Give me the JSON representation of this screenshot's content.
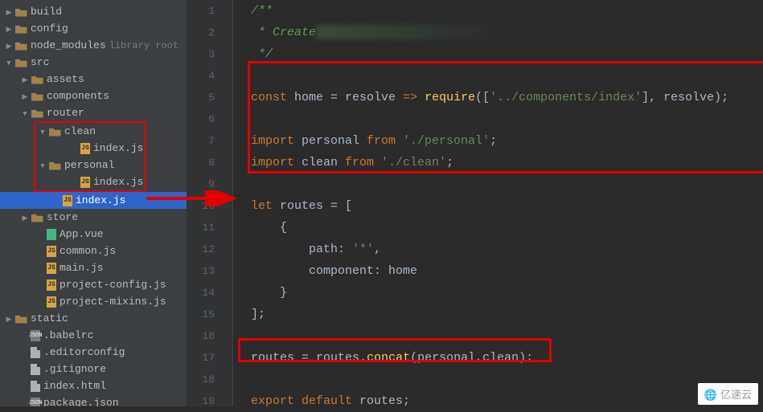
{
  "tree": {
    "build": "build",
    "config": "config",
    "node_modules": "node_modules",
    "node_modules_hint": "library root",
    "src": "src",
    "assets": "assets",
    "components": "components",
    "router": "router",
    "clean": "clean",
    "clean_index": "index.js",
    "personal": "personal",
    "personal_index": "index.js",
    "router_index": "index.js",
    "store": "store",
    "app_vue": "App.vue",
    "common_js": "common.js",
    "main_js": "main.js",
    "project_config": "project-config.js",
    "project_mixins": "project-mixins.js",
    "static": "static",
    "babelrc": ".babelrc",
    "editorconfig": ".editorconfig",
    "gitignore": ".gitignore",
    "index_html": "index.html",
    "package_json": "package.json"
  },
  "line_numbers": [
    "1",
    "2",
    "3",
    "4",
    "5",
    "6",
    "7",
    "8",
    "9",
    "10",
    "11",
    "12",
    "13",
    "14",
    "15",
    "16",
    "17",
    "18",
    "19"
  ],
  "code": {
    "l1": "/**",
    "l2_a": " * ",
    "l2_b": "Create",
    "l3": " */",
    "l5_const": "const ",
    "l5_home": "home",
    "l5_eq": " = ",
    "l5_res": "resolve",
    "l5_arrow": " => ",
    "l5_req": "require",
    "l5_p1": "([",
    "l5_str": "'../components/index'",
    "l5_p2": "], ",
    "l5_res2": "resolve",
    "l5_p3": ");",
    "l7_import": "import ",
    "l7_name": "personal",
    "l7_from": " from ",
    "l7_str": "'./personal'",
    "l7_semi": ";",
    "l8_name": "clean",
    "l8_str": "'./clean'",
    "l10_let": "let ",
    "l10_routes": "routes",
    "l10_eq": " = [",
    "l11": "    {",
    "l12_path": "        path",
    "l12_c": ": ",
    "l12_str": "'*'",
    "l12_comma": ",",
    "l13_comp": "        component",
    "l13_c": ": ",
    "l13_home": "home",
    "l14": "    }",
    "l15": "];",
    "l17_routes": "routes",
    "l17_eq": " = ",
    "l17_routes2": "routes",
    "l17_dot": ".",
    "l17_concat": "concat",
    "l17_p1": "(",
    "l17_personal": "personal",
    "l17_comma": ",",
    "l17_clean": "clean",
    "l17_p2": ");",
    "l19_export": "export ",
    "l19_default": "default ",
    "l19_routes": "routes",
    "l19_semi": ";"
  },
  "js_label": "JS",
  "json_label": "JSON",
  "watermark": "亿速云"
}
